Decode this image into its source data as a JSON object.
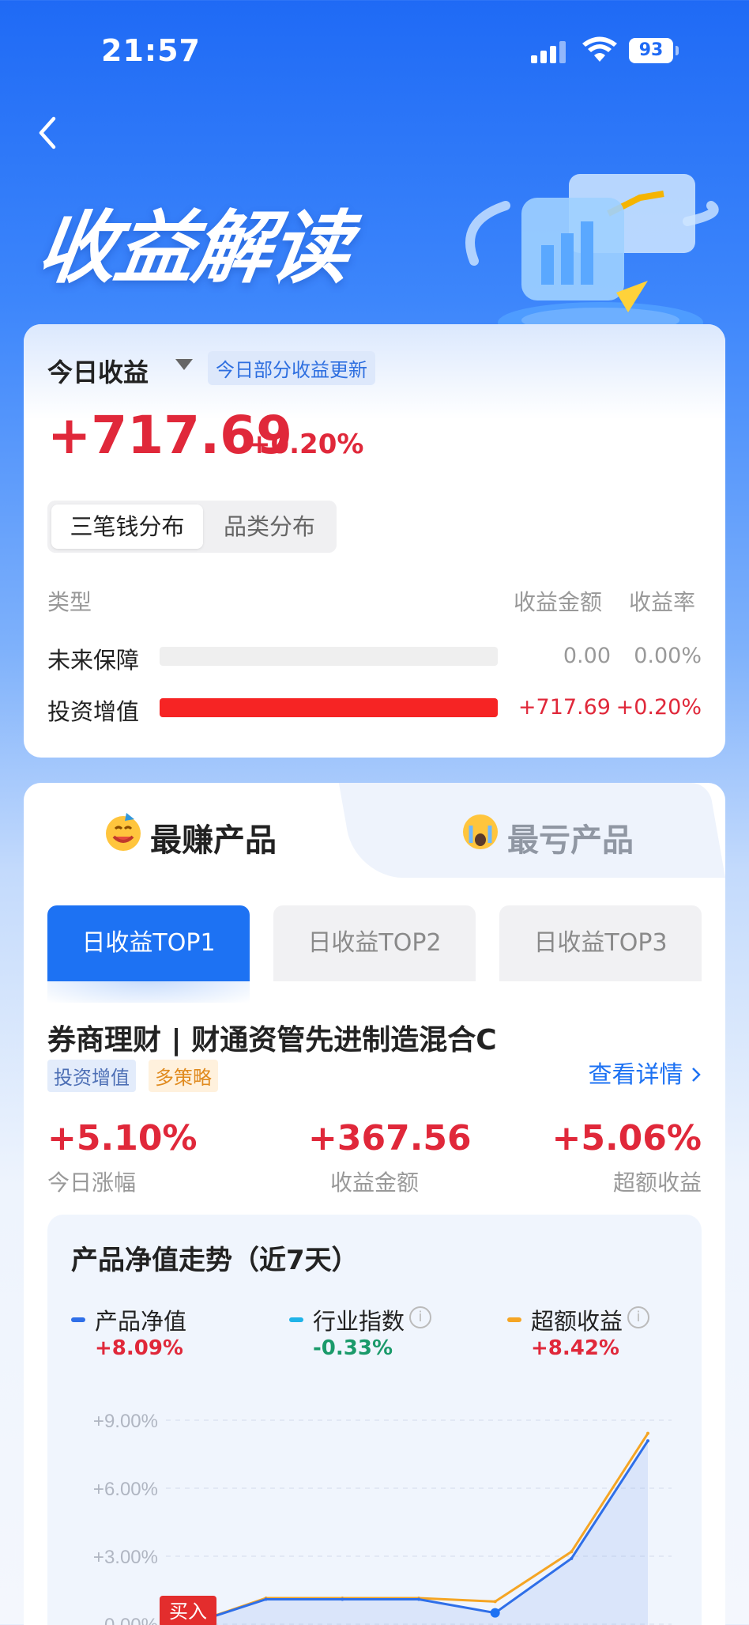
{
  "status_bar": {
    "time": "21:57",
    "battery": "93"
  },
  "header": {
    "title": "收益解读"
  },
  "today": {
    "label": "今日收益",
    "update_badge": "今日部分收益更新",
    "amount": "+717.69",
    "rate": "+0.20%",
    "segments": [
      "三笔钱分布",
      "品类分布"
    ],
    "columns": {
      "type": "类型",
      "amount": "收益金额",
      "rate": "收益率"
    },
    "rows": [
      {
        "label": "未来保障",
        "amount": "0.00",
        "rate": "0.00%",
        "fill": 0
      },
      {
        "label": "投资增值",
        "amount": "+717.69",
        "rate": "+0.20%",
        "fill": 1
      }
    ]
  },
  "ranking": {
    "tab_best": "最赚产品",
    "tab_worst": "最亏产品",
    "top_buttons": [
      "日收益TOP1",
      "日收益TOP2",
      "日收益TOP3"
    ],
    "product_title": "券商理财 | 财通资管先进制造混合C",
    "tags": [
      "投资增值",
      "多策略"
    ],
    "detail_link": "查看详情",
    "stats": [
      {
        "value": "+5.10%",
        "label": "今日涨幅"
      },
      {
        "value": "+367.56",
        "label": "收益金额"
      },
      {
        "value": "+5.06%",
        "label": "超额收益"
      }
    ]
  },
  "chart_card": {
    "title": "产品净值走势（近7天）",
    "legend": [
      {
        "name": "产品净值",
        "value": "+8.09%",
        "color": "#2f6fe8",
        "value_color": "#e0283a"
      },
      {
        "name": "行业指数",
        "value": "-0.33%",
        "color": "#1fb3e8",
        "value_color": "#1a9a6a"
      },
      {
        "name": "超额收益",
        "value": "+8.42%",
        "color": "#f5a524",
        "value_color": "#e0283a"
      }
    ],
    "buy_label": "买入"
  },
  "chart_data": {
    "type": "line",
    "yticks": [
      "+9.00%",
      "+6.00%",
      "+3.00%",
      "0.00%"
    ],
    "ylim": [
      0,
      9
    ],
    "x": [
      1,
      2,
      3,
      4,
      5,
      6,
      7
    ],
    "series": [
      {
        "name": "产品净值",
        "color": "#2f6fe8",
        "values": [
          0.0,
          1.1,
          1.1,
          1.1,
          0.5,
          2.9,
          8.09
        ]
      },
      {
        "name": "超额收益",
        "color": "#f5a524",
        "values": [
          0.0,
          1.15,
          1.15,
          1.15,
          1.0,
          3.2,
          8.42
        ]
      }
    ]
  }
}
